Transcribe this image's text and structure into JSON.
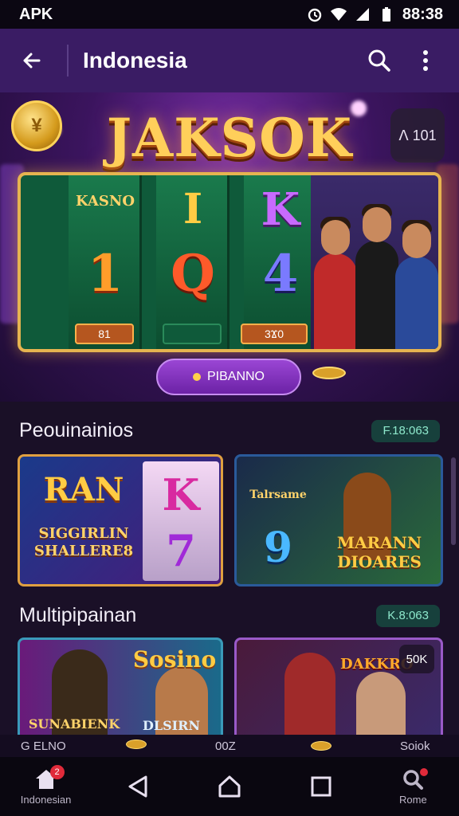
{
  "status_bar": {
    "left": "APK",
    "time": "88:38"
  },
  "appbar": {
    "title": "Indonesia"
  },
  "hero": {
    "title": "JAKSOK",
    "badge": "ꓥ 101",
    "coin_symbol": "¥",
    "reels": {
      "top": [
        "KASNO",
        "Ι",
        "K",
        "Q"
      ],
      "middle": [
        "1",
        "Q",
        "4"
      ],
      "plates": [
        "81",
        "",
        "3Ϫ0"
      ]
    },
    "play_button": "PIBANNO"
  },
  "section1": {
    "title": "Peouinainios",
    "pill": "F.18:063",
    "cards": [
      {
        "title": "RAN",
        "subtitle": "SIGGIRLIN SHALLERE8",
        "reel_top": "K",
        "reel_bottom": "7"
      },
      {
        "title": "MARANN DIOARES",
        "tag": "Talrsame",
        "reel": "9"
      }
    ]
  },
  "section2": {
    "title": "Multipipainan",
    "pill": "K.8:063",
    "cards": [
      {
        "title": "Sosino",
        "left_caption": "SUNABIENK",
        "right_caption": "DLSIRN"
      },
      {
        "title": "DAKKRO",
        "badge": "50K"
      }
    ]
  },
  "bottom_strip": {
    "left": "G ELNO",
    "middle": "00Z",
    "right": "Soiok"
  },
  "navbar": {
    "items": [
      {
        "label": "Indonesian",
        "badge": "2"
      },
      {
        "label": ""
      },
      {
        "label": ""
      },
      {
        "label": ""
      },
      {
        "label": "Rome"
      }
    ]
  }
}
